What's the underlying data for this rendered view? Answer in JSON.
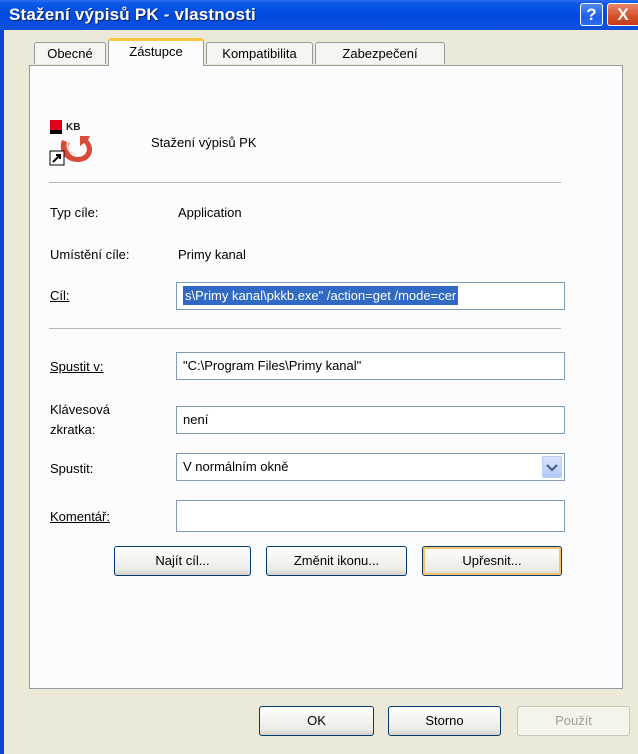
{
  "window": {
    "title": "Stažení výpisů PK - vlastnosti",
    "help_label": "?",
    "close_label": "X"
  },
  "tabs": [
    {
      "label": "Obecné"
    },
    {
      "label": "Zástupce"
    },
    {
      "label": "Kompatibilita"
    },
    {
      "label": "Zabezpečení"
    }
  ],
  "shortcut": {
    "icon_brand": "KB",
    "name": "Stažení výpisů PK",
    "target_type_label": "Typ cíle:",
    "target_type_value": "Application",
    "target_location_label": "Umístění cíle:",
    "target_location_value": "Primy kanal",
    "target_label": "Cíl:",
    "target_value": "s\\Primy kanal\\pkkb.exe\" /action=get /mode=cer",
    "start_in_label": "Spustit v:",
    "start_in_value": "\"C:\\Program Files\\Primy kanal\"",
    "hotkey_label_1": "Klávesová",
    "hotkey_label_2": "zkratka:",
    "hotkey_value": "není",
    "run_label": "Spustit:",
    "run_value": "V normálním okně",
    "comment_label": "Komentář:",
    "comment_value": ""
  },
  "buttons": {
    "find_target": "Najít cíl...",
    "change_icon": "Změnit ikonu...",
    "advanced": "Upřesnit...",
    "ok": "OK",
    "cancel": "Storno",
    "apply": "Použít"
  },
  "colors": {
    "titlebar": "#0149df",
    "dialog": "#ece9d8",
    "tab_highlight": "#ffc83c",
    "selection": "#316ac5"
  }
}
